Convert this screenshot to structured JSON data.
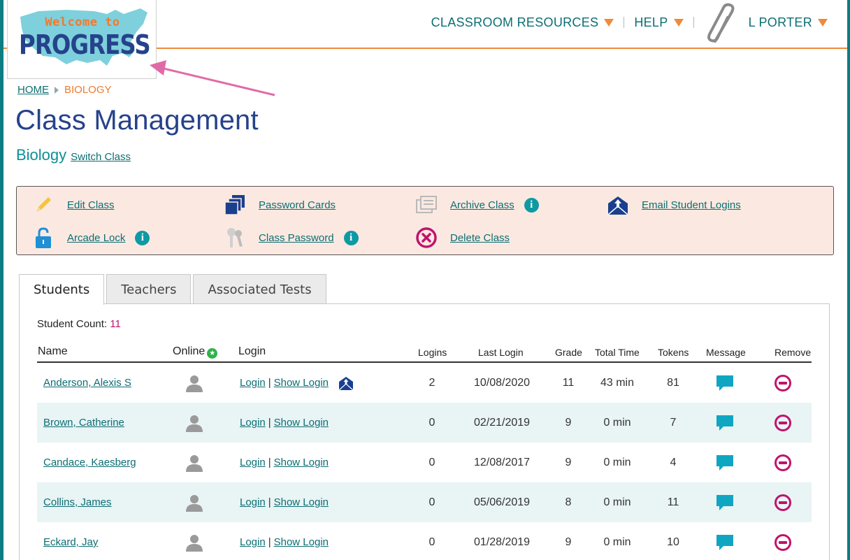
{
  "logo": {
    "line1": "Welcome to",
    "line2": "PROGRESS"
  },
  "nav": {
    "classroom_resources": "CLASSROOM RESOURCES",
    "help": "HELP",
    "user": "L PORTER"
  },
  "breadcrumb": {
    "home": "HOME",
    "current": "BIOLOGY"
  },
  "page_title": "Class Management",
  "class_info": {
    "name": "Biology",
    "switch_label": "Switch Class"
  },
  "actions": {
    "edit_class": "Edit Class",
    "password_cards": "Password Cards",
    "archive_class": "Archive Class",
    "email_student_logins": "Email Student Logins",
    "arcade_lock": "Arcade Lock",
    "class_password": "Class Password",
    "delete_class": "Delete Class",
    "info_glyph": "i"
  },
  "tabs": [
    "Students",
    "Teachers",
    "Associated Tests"
  ],
  "student_count": {
    "label": "Student Count:",
    "value": "11"
  },
  "table": {
    "headers": {
      "name": "Name",
      "online": "Online",
      "login": "Login",
      "logins": "Logins",
      "last_login": "Last Login",
      "grade": "Grade",
      "total_time": "Total Time",
      "tokens": "Tokens",
      "message": "Message",
      "remove": "Remove"
    },
    "login_link": "Login",
    "show_login_link": "Show Login",
    "separator": "|",
    "rows": [
      {
        "name": "Anderson, Alexis S",
        "logins": "2",
        "last_login": "10/08/2020",
        "grade": "11",
        "total_time": "43 min",
        "tokens": "81"
      },
      {
        "name": "Brown, Catherine",
        "logins": "0",
        "last_login": "02/21/2019",
        "grade": "9",
        "total_time": "0 min",
        "tokens": "7"
      },
      {
        "name": "Candace, Kaesberg",
        "logins": "0",
        "last_login": "12/08/2017",
        "grade": "9",
        "total_time": "0 min",
        "tokens": "4"
      },
      {
        "name": "Collins, James",
        "logins": "0",
        "last_login": "05/06/2019",
        "grade": "8",
        "total_time": "0 min",
        "tokens": "11"
      },
      {
        "name": "Eckard, Jay",
        "logins": "0",
        "last_login": "01/28/2019",
        "grade": "9",
        "total_time": "0 min",
        "tokens": "10"
      }
    ]
  },
  "colors": {
    "teal_frame": "#0c7d83",
    "accent_orange": "#f08a3a",
    "title_navy": "#26428b",
    "link_teal": "#0c6e73",
    "actions_bg": "#fbe9e1",
    "count_magenta": "#c0136e",
    "alt_row": "#e9f4f5",
    "annotation_arrow": "#e06aa8"
  }
}
